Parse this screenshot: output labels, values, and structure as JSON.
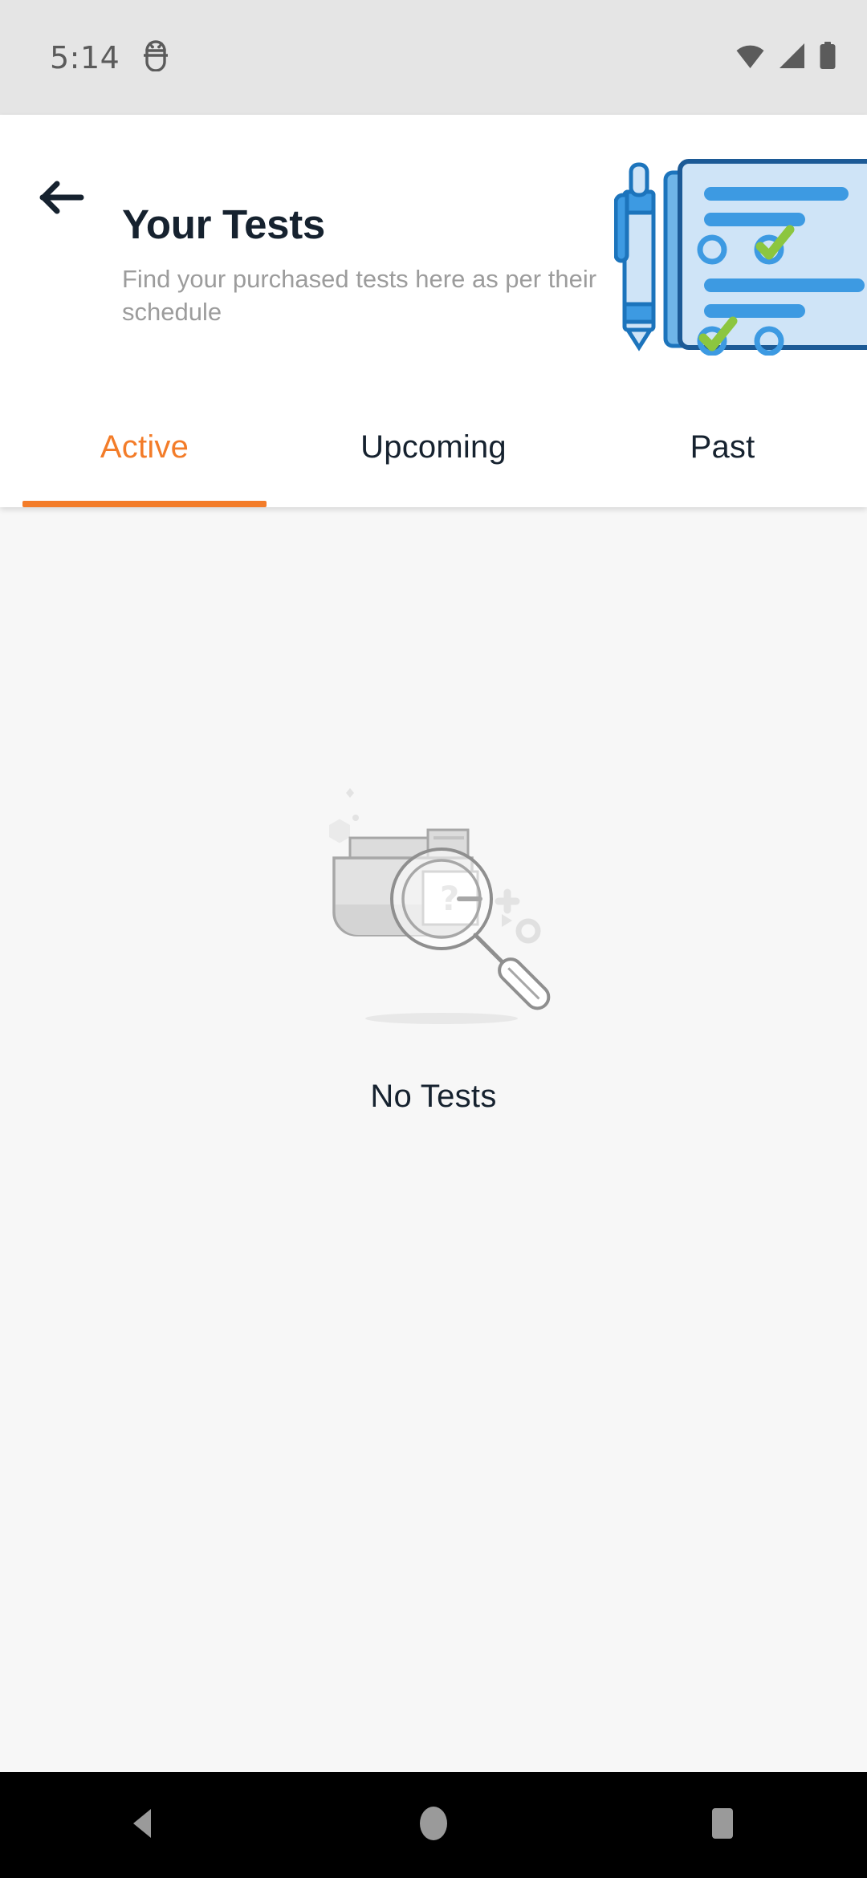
{
  "status_bar": {
    "time": "5:14",
    "icons": [
      "android-debug-icon",
      "wifi-icon",
      "cellular-signal-icon",
      "battery-icon"
    ],
    "background": "#E5E5E5",
    "foreground": "#5B5B5B"
  },
  "header": {
    "back_label": "back-arrow",
    "title": "Your Tests",
    "subtitle": "Find your purchased tests here as per their schedule",
    "illustration": "clipboard-checklist-with-pen",
    "title_color": "#16222F",
    "subtitle_color": "#9C9C9C"
  },
  "tabs": {
    "active_index": 0,
    "accent_color": "#F37C29",
    "items": [
      {
        "label": "Active"
      },
      {
        "label": "Upcoming"
      },
      {
        "label": "Past"
      }
    ]
  },
  "empty_state": {
    "illustration": "folder-with-magnifier-question-icon",
    "message": "No Tests"
  },
  "nav_bar": {
    "background": "#000000",
    "icon_color": "#9A9A9A",
    "buttons": [
      {
        "name": "back",
        "glyph": "triangle-left"
      },
      {
        "name": "home",
        "glyph": "circle"
      },
      {
        "name": "recents",
        "glyph": "square"
      }
    ]
  }
}
